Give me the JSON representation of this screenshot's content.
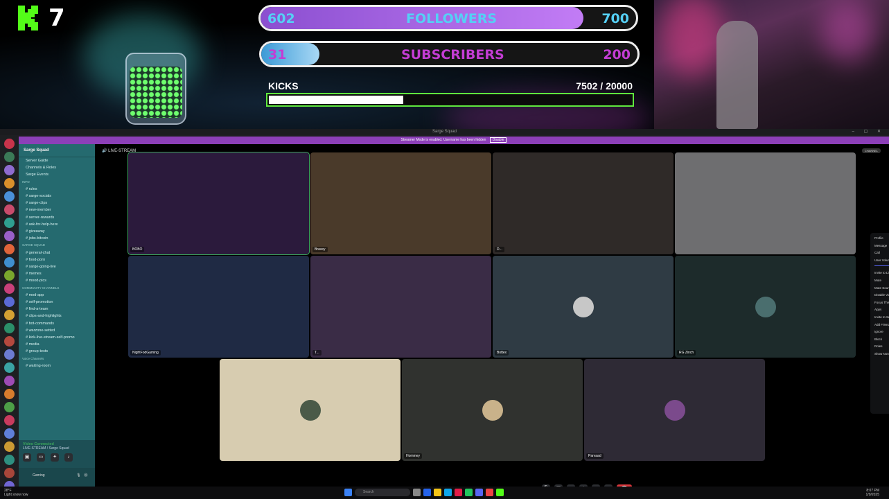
{
  "overlay": {
    "kick_count": "7",
    "followers": {
      "label": "FOLLOWERS",
      "current": "602",
      "goal": "700",
      "progress": 0.86
    },
    "subscribers": {
      "label": "SUBSCRIBERS",
      "current": "31",
      "goal": "200",
      "progress": 0.155
    },
    "kicks": {
      "label": "KICKS",
      "value": "7502 / 20000",
      "progress": 0.375
    },
    "colors": {
      "kick_green": "#53fc18",
      "followers_text": "#55d0f5",
      "subs_text": "#c33dd3"
    }
  },
  "discord": {
    "window_title": "Sarge Squad",
    "notice": {
      "text": "Streamer Mode is enabled. Username has been hidden",
      "button": "Disable"
    },
    "server_name": "Sarge Squad",
    "channels": [
      {
        "label": "Server Guide",
        "cat": false
      },
      {
        "label": "Channels & Roles",
        "cat": false
      },
      {
        "label": "Sarge Events",
        "cat": false
      },
      {
        "label": "INFO",
        "cat": true
      },
      {
        "label": "# rules",
        "cat": false
      },
      {
        "label": "# sarge-socials",
        "cat": false
      },
      {
        "label": "# sarge-clips",
        "cat": false
      },
      {
        "label": "# new-member",
        "cat": false
      },
      {
        "label": "# server-rewards",
        "cat": false
      },
      {
        "label": "# ask-for-help-here",
        "cat": false
      },
      {
        "label": "# giveaway",
        "cat": false
      },
      {
        "label": "# jobs-bitcoin",
        "cat": false
      },
      {
        "label": "SARGE SQUAD",
        "cat": true
      },
      {
        "label": "# general-chat",
        "cat": false
      },
      {
        "label": "# food-porn",
        "cat": false
      },
      {
        "label": "# sarge-going-live",
        "cat": false
      },
      {
        "label": "# memes",
        "cat": false
      },
      {
        "label": "# mood-pics",
        "cat": false
      },
      {
        "label": "COMMUNITY CHANNELS",
        "cat": true
      },
      {
        "label": "# mod-app",
        "cat": false
      },
      {
        "label": "# self-promotion",
        "cat": false
      },
      {
        "label": "# find-a-team",
        "cat": false
      },
      {
        "label": "# clips-and-highlights",
        "cat": false
      },
      {
        "label": "# bot-commands",
        "cat": false
      },
      {
        "label": "# warzone-setted",
        "cat": false
      },
      {
        "label": "# kick-live-stream-self-promo",
        "cat": false
      },
      {
        "label": "# media",
        "cat": false
      },
      {
        "label": "# group-tests",
        "cat": false
      },
      {
        "label": "Voice Channels",
        "cat": true
      },
      {
        "label": "# waiting-room",
        "cat": false
      }
    ],
    "voice_panel": {
      "title": "Video Connected",
      "subtitle": "LIVE-STREAM / Sarge Squad"
    },
    "user_panel": {
      "status": "Gaming"
    },
    "main_header": {
      "channel": "LIVE-STREAM",
      "end_button": "CHANNEL"
    },
    "tiles": [
      {
        "name": "BOBO",
        "color": "#2b1a3c",
        "avatar": false
      },
      {
        "name": "Bravey",
        "color": "#4a3a2a",
        "avatar": false
      },
      {
        "name": "D...",
        "color": "#2f2a28",
        "avatar": false
      },
      {
        "name": "",
        "color": "#6e6e70",
        "avatar": false
      },
      {
        "name": "NightFodGaming",
        "color": "#1f2a44",
        "avatar": false
      },
      {
        "name": "T...",
        "color": "#3a2c46",
        "avatar": false
      },
      {
        "name": "Bottex",
        "color": "#2f3b44",
        "avatar": true,
        "avatar_color": "#c7c7c7"
      },
      {
        "name": "RG Zinch",
        "color": "#1d2b2b",
        "avatar": true,
        "avatar_color": "#4a6e6e"
      },
      {
        "name": "",
        "color": "#d7ccb0",
        "avatar": true,
        "avatar_color": "#4a5a48"
      },
      {
        "name": "Hommey",
        "color": "#30322f",
        "avatar": true,
        "avatar_color": "#c9b28a"
      },
      {
        "name": "Parvaad",
        "color": "#2e2a35",
        "avatar": true,
        "avatar_color": "#7b4a8c"
      }
    ],
    "context_menu": [
      {
        "label": "Profile",
        "check": ""
      },
      {
        "label": "Message",
        "check": ""
      },
      {
        "label": "Call",
        "check": ""
      },
      {
        "label": "User Volume",
        "check": ""
      },
      {
        "label": "Invite to Listen Along",
        "check": ""
      },
      {
        "label": "Mute",
        "check": "off"
      },
      {
        "label": "Mute Soundboard",
        "check": "off"
      },
      {
        "label": "Disable Video",
        "check": "off"
      },
      {
        "label": "Focus This Person",
        "check": ""
      },
      {
        "label": "Apps",
        "check": ""
      },
      {
        "label": "Invite to Server",
        "check": ""
      },
      {
        "label": "Add Friend",
        "check": ""
      },
      {
        "label": "Ignore",
        "check": ""
      },
      {
        "label": "Block",
        "check": ""
      },
      {
        "label": "Roles",
        "check": ""
      },
      {
        "label": "Show Non-Video Participants",
        "check": "on"
      }
    ],
    "user_volume_level": 0.5
  },
  "taskbar": {
    "weather": "28°F",
    "weather_sub": "Light snow now",
    "search_placeholder": "Search",
    "time": "8:07 PM",
    "date": "1/9/2025"
  }
}
